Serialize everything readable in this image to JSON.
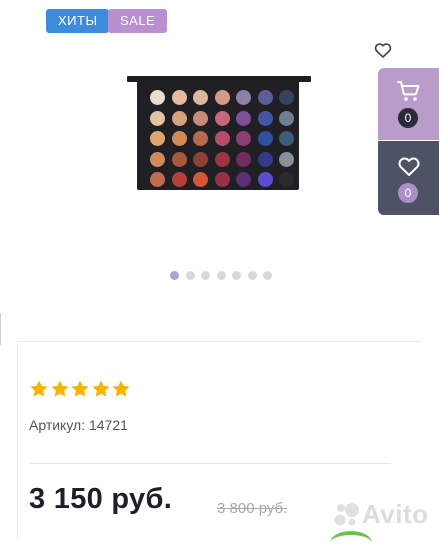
{
  "badges": {
    "hits": "ХИТЫ",
    "sale": "SALE"
  },
  "product": {
    "rating_stars": 5,
    "sku": "Артикул: 14721",
    "price_current": "3 150 руб.",
    "price_old": "3 800 руб."
  },
  "gallery": {
    "image_count": 7,
    "active_index": 0
  },
  "side_panel": {
    "cart_count": "0",
    "favorites_count": "0"
  },
  "watermark": {
    "text": "Avito"
  },
  "palette_colors": [
    [
      "#e8ddd0",
      "#e6b9a4",
      "#dcb7a0",
      "#d59988",
      "#8e7fa6",
      "#5a5f9a",
      "#36435f"
    ],
    [
      "#e4c3a3",
      "#d9a27f",
      "#c78a76",
      "#c4687a",
      "#7f4f97",
      "#4654a8",
      "#6d7f90"
    ],
    [
      "#e0a66f",
      "#d08a58",
      "#b86a4c",
      "#b64d67",
      "#8d3e78",
      "#2f4fa0",
      "#3b5d7a"
    ],
    [
      "#d08a5c",
      "#a9593e",
      "#8a4431",
      "#9d3443",
      "#722c5e",
      "#343b86",
      "#8a8f9a"
    ],
    [
      "#c06a50",
      "#b3403a",
      "#d6563a",
      "#963049",
      "#5a2f76",
      "#5b4fcf",
      "#2b2b2f"
    ]
  ],
  "colors": {
    "badge_hits": "#3d8bd9",
    "badge_sale": "#b98fd0",
    "cart_panel": "#b99cc9",
    "fav_panel": "#4d5264",
    "star": "#f5b400"
  }
}
